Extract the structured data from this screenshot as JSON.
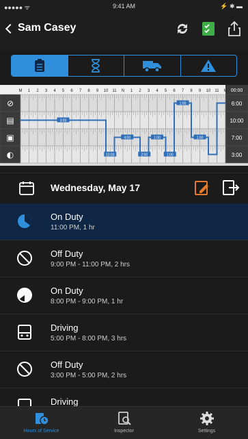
{
  "status_bar": {
    "carrier": "●●●●● ᯤ",
    "time": "9:41 AM",
    "battery": "⚡ ✱ ▬"
  },
  "header": {
    "back_label": "Sam Casey"
  },
  "tabs": [
    "logs-tab",
    "timer-tab",
    "truck-tab",
    "alert-tab"
  ],
  "grid": {
    "hours": [
      "M",
      "1",
      "2",
      "3",
      "4",
      "5",
      "6",
      "7",
      "8",
      "9",
      "10",
      "11",
      "N",
      "1",
      "2",
      "3",
      "4",
      "5",
      "6",
      "7",
      "8",
      "9",
      "10",
      "11",
      "M"
    ],
    "rows": [
      "off-duty",
      "sleeper",
      "driving",
      "on-duty"
    ],
    "totals_header": "00:00",
    "totals": [
      "6:00",
      "10:00",
      "7:00",
      "3:00"
    ],
    "segment_labels": [
      "3:00",
      "10:00",
      "4:00",
      "2:00",
      "1:00",
      "1:00",
      "1:00",
      "1:00"
    ]
  },
  "date_label": "Wednesday, May 17",
  "entries": [
    {
      "status": "On Duty",
      "time": "11:00 PM, 1 hr",
      "icon": "on-duty-icon",
      "active": true
    },
    {
      "status": "Off Duty",
      "time": "9:00 PM - 11:00 PM, 2 hrs",
      "icon": "off-duty-icon",
      "active": false
    },
    {
      "status": "On Duty",
      "time": "8:00 PM - 9:00 PM, 1 hr",
      "icon": "on-duty-icon",
      "active": false
    },
    {
      "status": "Driving",
      "time": "5:00 PM - 8:00 PM, 3 hrs",
      "icon": "driving-icon",
      "active": false
    },
    {
      "status": "Off Duty",
      "time": "3:00 PM - 5:00 PM, 2 hrs",
      "icon": "off-duty-icon",
      "active": false
    },
    {
      "status": "Driving",
      "time": "",
      "icon": "driving-icon",
      "active": false
    }
  ],
  "tabbar": [
    {
      "label": "Hours of Service",
      "icon": "hours-of-service-icon",
      "active": true
    },
    {
      "label": "Inspector",
      "icon": "inspector-icon",
      "active": false
    },
    {
      "label": "Settings",
      "icon": "settings-icon",
      "active": false
    }
  ],
  "colors": {
    "accent": "#2f8fdc",
    "active_row": "#0f2744",
    "edit_orange": "#e8782b",
    "check_green": "#3fae48"
  }
}
